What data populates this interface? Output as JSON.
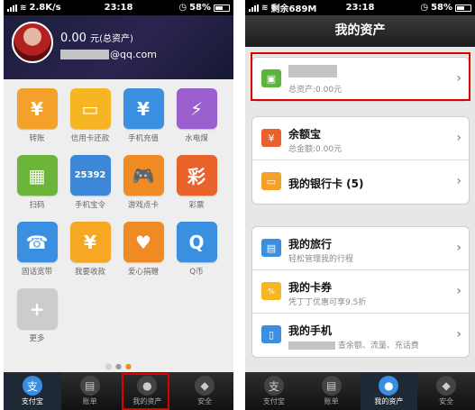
{
  "left_phone": {
    "status": {
      "speed": "2.8K/s",
      "time": "23:18",
      "battery": "58%"
    },
    "header": {
      "balance": "0.00",
      "balance_unit": "元(总资产)",
      "email_suffix": "@qq.com"
    },
    "grid": [
      {
        "label": "转账",
        "icon": "transfer-icon",
        "color": "#f3a12a",
        "glyph": "¥"
      },
      {
        "label": "信用卡还款",
        "icon": "credit-card-icon",
        "color": "#f6b623",
        "glyph": "▭"
      },
      {
        "label": "手机充值",
        "icon": "phone-topup-icon",
        "color": "#3a8fe0",
        "glyph": "¥"
      },
      {
        "label": "水电煤",
        "icon": "utilities-icon",
        "color": "#9b5fcf",
        "glyph": "⚡"
      },
      {
        "label": "扫码",
        "icon": "qr-scan-icon",
        "color": "#6db43b",
        "glyph": "▦"
      },
      {
        "label": "手机宝令",
        "icon": "token-icon",
        "color": "#3d87d8",
        "glyph": "25392"
      },
      {
        "label": "游戏点卡",
        "icon": "gamepad-icon",
        "color": "#f08a23",
        "glyph": "🎮"
      },
      {
        "label": "彩票",
        "icon": "lottery-icon",
        "color": "#e8622c",
        "glyph": "彩"
      },
      {
        "label": "固话宽带",
        "icon": "landline-icon",
        "color": "#3a8fe0",
        "glyph": "☎"
      },
      {
        "label": "我要收款",
        "icon": "receive-money-icon",
        "color": "#f6a824",
        "glyph": "¥"
      },
      {
        "label": "爱心捐赠",
        "icon": "heart-icon",
        "color": "#f08a23",
        "glyph": "♥"
      },
      {
        "label": "Q币",
        "icon": "qq-coin-icon",
        "color": "#3a8fe0",
        "glyph": "Q"
      },
      {
        "label": "更多",
        "icon": "plus-icon",
        "color": "#cccccc",
        "glyph": "+"
      }
    ],
    "tabs": [
      {
        "label": "支付宝",
        "icon": "alipay-icon",
        "glyph": "支"
      },
      {
        "label": "账单",
        "icon": "bill-icon",
        "glyph": "▤"
      },
      {
        "label": "我的资产",
        "icon": "assets-icon",
        "glyph": "●"
      },
      {
        "label": "安全",
        "icon": "shield-icon",
        "glyph": "◆"
      }
    ]
  },
  "right_phone": {
    "status": {
      "carrier_info": "剩余689M",
      "time": "23:18",
      "battery": "58%"
    },
    "title": "我的资产",
    "account": {
      "total": "总资产:0.00元"
    },
    "yuebao": {
      "title": "余额宝",
      "sub": "总金额:0.00元"
    },
    "bankcard": {
      "title": "我的银行卡 (5)"
    },
    "travel": {
      "title": "我的旅行",
      "sub": "轻松管理我的行程"
    },
    "coupon": {
      "title": "我的卡券",
      "sub": "凭丁丁优惠可享9.5折"
    },
    "phone": {
      "title": "我的手机",
      "sub": "查余额、流量、充话费"
    },
    "tabs": [
      {
        "label": "支付宝",
        "icon": "alipay-icon",
        "glyph": "支"
      },
      {
        "label": "账单",
        "icon": "bill-icon",
        "glyph": "▤"
      },
      {
        "label": "我的资产",
        "icon": "assets-icon",
        "glyph": "●"
      },
      {
        "label": "安全",
        "icon": "shield-icon",
        "glyph": "◆"
      }
    ]
  },
  "colors": {
    "highlight": "#e00000",
    "active_tab": "#3a8de0"
  }
}
